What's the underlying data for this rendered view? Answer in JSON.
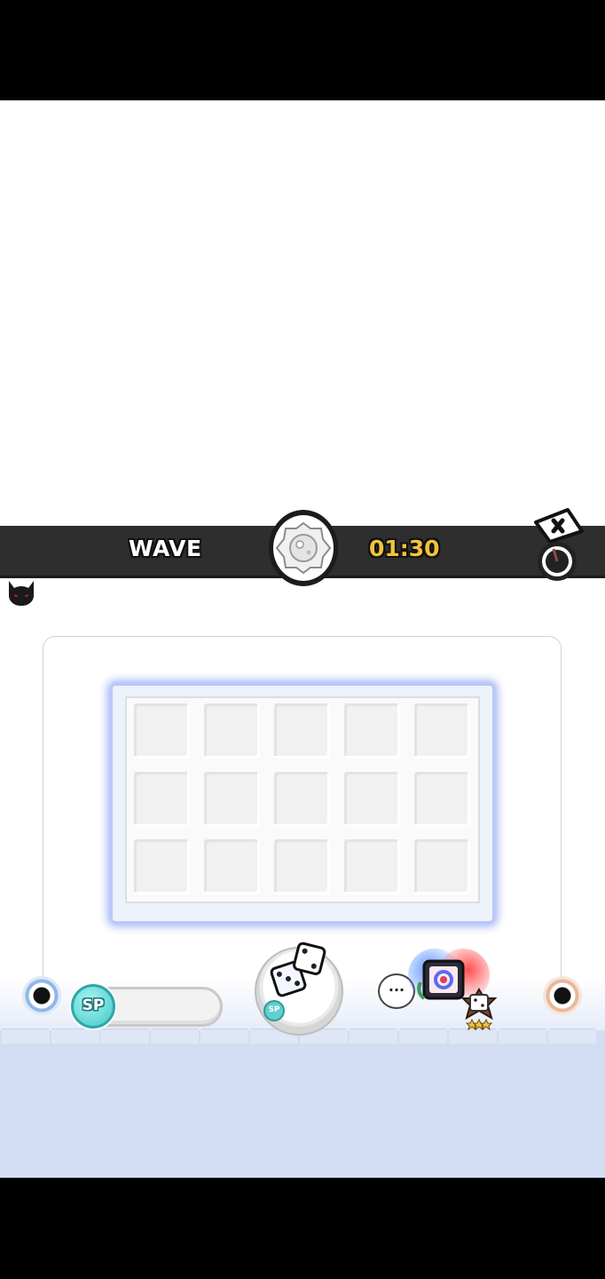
{
  "hud": {
    "wave_label": "WAVE",
    "timer": "01:30",
    "timer_color": "#f2c23b"
  },
  "sp": {
    "badge_label": "SP"
  },
  "summon": {
    "sp_label": "SP"
  },
  "chat": {
    "label": "···"
  },
  "board": {
    "rows": 3,
    "cols": 5
  },
  "colors": {
    "hud_bar": "#2e2e2e",
    "floor": "#d2ddf3",
    "grid_glow": "#9fb3f3",
    "sp_accent": "#3fc9c9"
  }
}
